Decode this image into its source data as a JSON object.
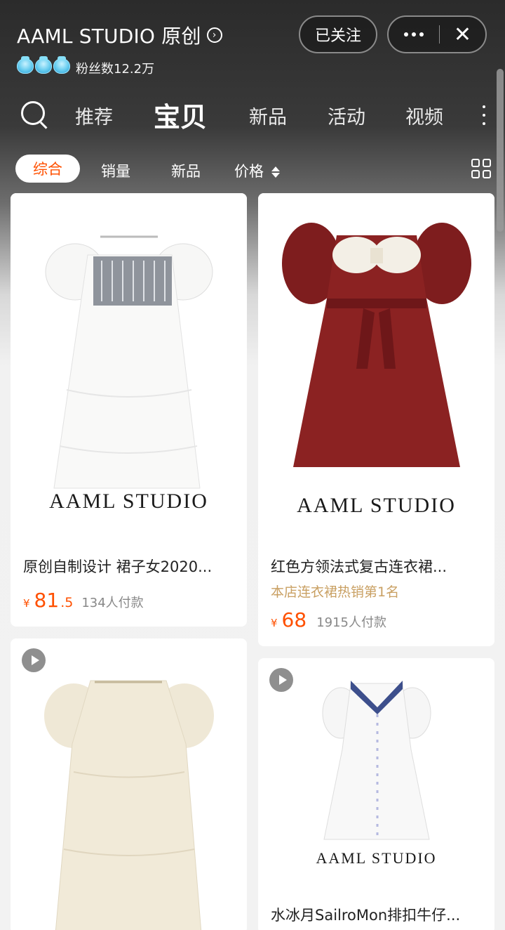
{
  "header": {
    "store_name": "AAML STUDIO 原创",
    "fans": "粉丝数12.2万",
    "follow_label": "已关注"
  },
  "nav": {
    "tabs": [
      {
        "label": "推荐"
      },
      {
        "label": "宝贝",
        "active": true
      },
      {
        "label": "新品"
      },
      {
        "label": "活动"
      },
      {
        "label": "视频"
      }
    ]
  },
  "sort": {
    "options": [
      "综合",
      "销量",
      "新品",
      "价格"
    ],
    "selected": "综合"
  },
  "colors": {
    "accent": "#ff5000",
    "tag": "#c9a063"
  },
  "products": [
    {
      "brand": "AAML STUDIO",
      "title": "原创自制设计 裙子女2020...",
      "price_symbol": "¥",
      "price_int": "81",
      "price_dec": ".5",
      "sold": "134人付款",
      "video": false
    },
    {
      "brand": "AAML STUDIO",
      "title": "红色方领法式复古连衣裙...",
      "tag": "本店连衣裙热销第1名",
      "price_symbol": "¥",
      "price_int": "68",
      "price_dec": "",
      "sold": "1915人付款",
      "video": false
    },
    {
      "brand": "",
      "title": "",
      "video": true
    },
    {
      "brand": "AAML STUDIO",
      "title": "水冰月SailroMon排扣牛仔...",
      "video": true
    }
  ]
}
